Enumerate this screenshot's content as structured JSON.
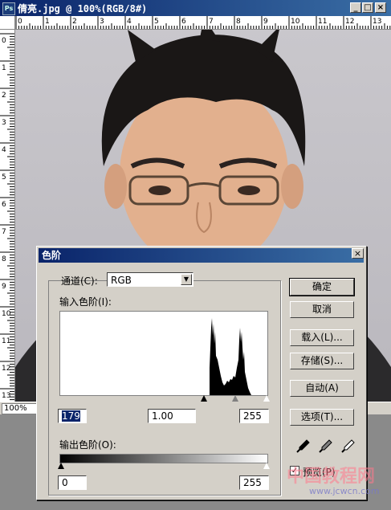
{
  "document": {
    "title": "倩亮.jpg @ 100%(RGB/8#)",
    "zoom": "100%",
    "title_buttons": [
      "_",
      "□",
      "×"
    ],
    "ruler_top_ticks": [
      "0",
      "1",
      "2",
      "3",
      "4",
      "5",
      "6",
      "7",
      "8",
      "9",
      "10",
      "11",
      "12",
      "13"
    ],
    "ruler_left_ticks": [
      "0",
      "1",
      "2",
      "3",
      "4",
      "5",
      "6",
      "7",
      "8",
      "9",
      "10",
      "11",
      "12",
      "13"
    ]
  },
  "dialog": {
    "title": "色阶",
    "close_label": "×",
    "channel_label": "通道(C):",
    "channel_value": "RGB",
    "input_levels_label": "输入色阶(I):",
    "input_black": "179",
    "input_gamma": "1.00",
    "input_white": "255",
    "output_levels_label": "输出色阶(O):",
    "output_black": "0",
    "output_white": "255",
    "buttons": {
      "ok": "确定",
      "cancel": "取消",
      "load": "载入(L)...",
      "save": "存储(S)...",
      "auto": "自动(A)",
      "options": "选项(T)..."
    },
    "preview_label": "预览(P)",
    "preview_checked": true,
    "eyedroppers": [
      "black-eyedropper-icon",
      "gray-eyedropper-icon",
      "white-eyedropper-icon"
    ]
  },
  "watermark": {
    "text": "中国教程网",
    "url": "www.jcwcn.com"
  },
  "colors": {
    "titlebar_start": "#0a246a",
    "titlebar_end": "#3a6ea5",
    "dialog_bg": "#d4d0c8"
  }
}
